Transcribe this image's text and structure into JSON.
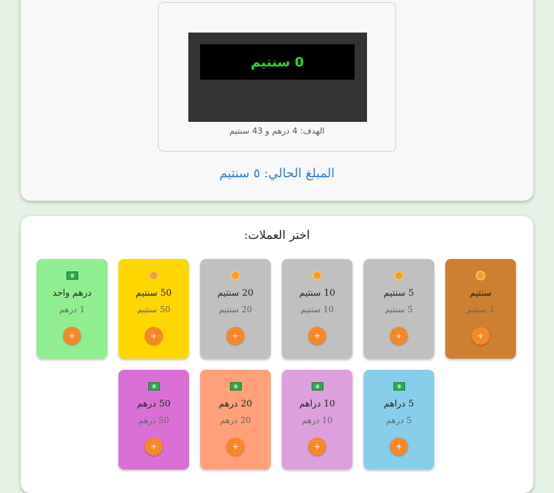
{
  "display": {
    "screen_text": "0 سنتيم",
    "target_text": "الهدف: 4 درهم و 43 سنتيم",
    "current_amount_text": "المبلغ الحالي: ٥ سنتيم"
  },
  "coins_section": {
    "title": "اختر العملات:"
  },
  "cards": [
    {
      "name": "سنتيم",
      "value": "1 سنتيم",
      "icon": "coin-icon",
      "color": "#cd7f32",
      "add_label": "+"
    },
    {
      "name": "5 سنتيم",
      "value": "5 سنتيم",
      "icon": "coin-icon",
      "color": "#c0c0c0",
      "add_label": "+"
    },
    {
      "name": "10 سنتيم",
      "value": "10 سنتيم",
      "icon": "coin-icon",
      "color": "#c0c0c0",
      "add_label": "+"
    },
    {
      "name": "20 سنتيم",
      "value": "20 سنتيم",
      "icon": "coin-icon",
      "color": "#c0c0c0",
      "add_label": "+"
    },
    {
      "name": "50 سنتيم",
      "value": "50 سنتيم",
      "icon": "coin-icon",
      "color": "#ffd700",
      "add_label": "+"
    },
    {
      "name": "درهم واحد",
      "value": "1 درهم",
      "icon": "banknote-icon",
      "color": "#90ee90",
      "add_label": "+"
    },
    {
      "name": "5 دراهم",
      "value": "5 درهم",
      "icon": "banknote-icon",
      "color": "#87ceeb",
      "add_label": "+"
    },
    {
      "name": "10 دراهم",
      "value": "10 درهم",
      "icon": "banknote-icon",
      "color": "#dda0dd",
      "add_label": "+"
    },
    {
      "name": "20 درهم",
      "value": "20 درهم",
      "icon": "banknote-icon",
      "color": "#ffa07a",
      "add_label": "+"
    },
    {
      "name": "50 درهم",
      "value": "50 درهم",
      "icon": "banknote-icon",
      "color": "#da70d6",
      "add_label": "+"
    }
  ]
}
